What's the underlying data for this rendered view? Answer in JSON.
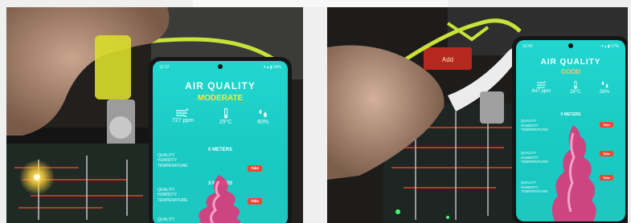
{
  "left_photo": {
    "phone": {
      "status_time": "12:37",
      "status_icons": "▾ ▴ ▮ 59%",
      "title": "AIR QUALITY",
      "level": "MODERATE",
      "metrics": [
        {
          "icon": "wind-icon",
          "value": "727 ppm"
        },
        {
          "icon": "thermometer-icon",
          "value": "29°C"
        },
        {
          "icon": "humidity-drops-icon",
          "value": "60%"
        }
      ],
      "section_0": "0 METERS",
      "section_3": "3 METERS",
      "rows": [
        "QUALITY",
        "HUMIDITY",
        "TEMPERATURE"
      ],
      "take_label": "Take",
      "partial_text": "QUALITY"
    }
  },
  "right_photo": {
    "board_label": "Add",
    "phone": {
      "status_time": "12:40",
      "status_icons": "▾ ▴ ▮ 57%",
      "title": "AIR QUALITY",
      "level": "GOOD",
      "metrics": [
        {
          "icon": "wind-icon",
          "value": "647 ppm"
        },
        {
          "icon": "thermometer-icon",
          "value": "29°C"
        },
        {
          "icon": "humidity-drops-icon",
          "value": "56%"
        }
      ],
      "section_0": "0 METERS",
      "rows": [
        "QUALITY",
        "HUMIDITY",
        "TEMPERATURE"
      ],
      "take_label": "Take"
    }
  },
  "colors": {
    "screen": "#1ec9c2",
    "level_moderate": "#ffe81a",
    "level_good": "#ffc07a",
    "take": "#e94b35",
    "plume": "#e0367a",
    "cable": "#c8e23a"
  }
}
